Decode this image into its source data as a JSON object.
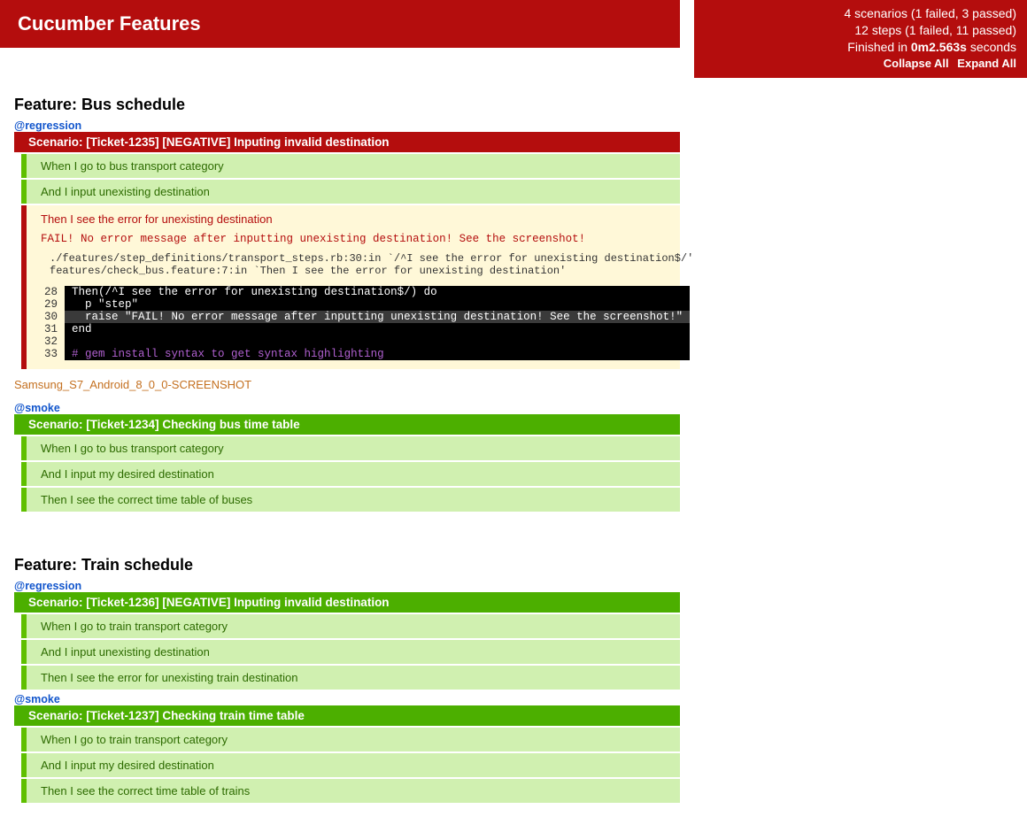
{
  "title": "Cucumber Features",
  "summary": {
    "scenarios": "4 scenarios (1 failed, 3 passed)",
    "steps": "12 steps (1 failed, 11 passed)",
    "finished_prefix": "Finished in ",
    "finished_time": "0m2.563s",
    "finished_suffix": " seconds",
    "collapse_all": "Collapse All",
    "expand_all": "Expand All"
  },
  "features": [
    {
      "title": "Feature: Bus schedule",
      "scenarios": [
        {
          "tag": "@regression",
          "status": "failed",
          "header": "Scenario: [Ticket-1235] [NEGATIVE] Inputing invalid destination",
          "steps": [
            {
              "type": "passed",
              "text": "When I go to bus transport category"
            },
            {
              "type": "passed",
              "text": "And I input unexisting destination"
            },
            {
              "type": "failed",
              "text": "Then I see the error for unexisting destination",
              "fail_msg": "FAIL! No error message after inputting unexisting destination! See the screenshot!",
              "backtrace": "./features/step_definitions/transport_steps.rb:30:in `/^I see the error for unexisting destination$/'\nfeatures/check_bus.feature:7:in `Then I see the error for unexisting destination'",
              "code": [
                {
                  "n": 28,
                  "text": "Then(/^I see the error for unexisting destination$/) do",
                  "hl": false
                },
                {
                  "n": 29,
                  "text": "  p \"step\"",
                  "hl": false
                },
                {
                  "n": 30,
                  "text": "  raise \"FAIL! No error message after inputting unexisting destination! See the screenshot!\"",
                  "hl": true
                },
                {
                  "n": 31,
                  "text": "end",
                  "hl": false
                },
                {
                  "n": 32,
                  "text": "",
                  "hl": false
                },
                {
                  "n": 33,
                  "text": "# gem install syntax to get syntax highlighting",
                  "hl": false,
                  "comment": true
                }
              ]
            }
          ],
          "screenshot": "Samsung_S7_Android_8_0_0-SCREENSHOT"
        },
        {
          "tag": "@smoke",
          "status": "passed",
          "header": "Scenario: [Ticket-1234] Checking bus time table",
          "steps": [
            {
              "type": "passed",
              "text": "When I go to bus transport category"
            },
            {
              "type": "passed",
              "text": "And I input my desired destination"
            },
            {
              "type": "passed",
              "text": "Then I see the correct time table of buses"
            }
          ]
        }
      ]
    },
    {
      "title": "Feature: Train schedule",
      "scenarios": [
        {
          "tag": "@regression",
          "status": "passed",
          "header": "Scenario: [Ticket-1236] [NEGATIVE] Inputing invalid destination",
          "steps": [
            {
              "type": "passed",
              "text": "When I go to train transport category"
            },
            {
              "type": "passed",
              "text": "And I input unexisting destination"
            },
            {
              "type": "passed",
              "text": "Then I see the error for unexisting train destination"
            }
          ]
        },
        {
          "tag": "@smoke",
          "status": "passed",
          "header": "Scenario: [Ticket-1237] Checking train time table",
          "steps": [
            {
              "type": "passed",
              "text": "When I go to train transport category"
            },
            {
              "type": "passed",
              "text": "And I input my desired destination"
            },
            {
              "type": "passed",
              "text": "Then I see the correct time table of trains"
            }
          ]
        }
      ]
    }
  ]
}
